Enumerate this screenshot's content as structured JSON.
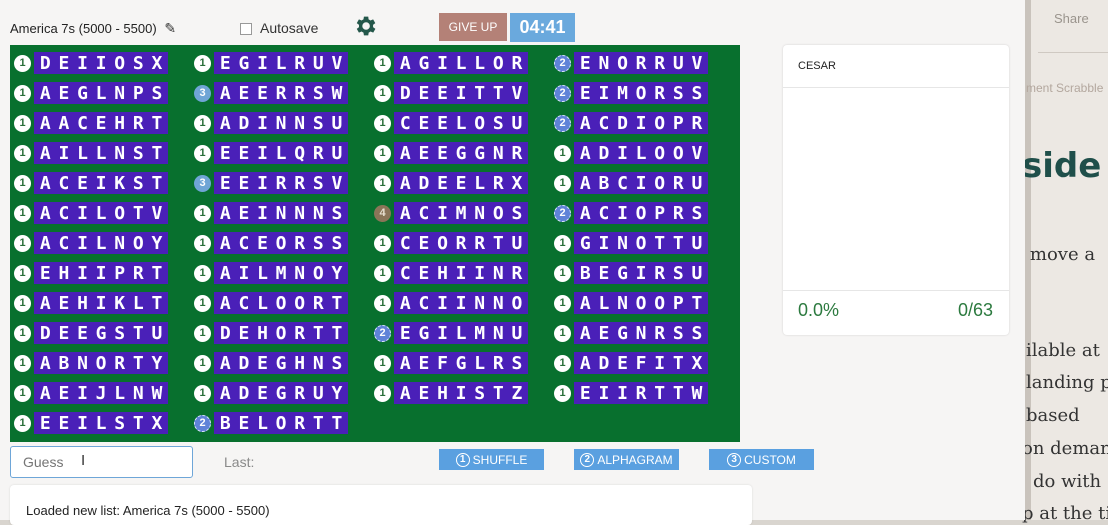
{
  "header": {
    "list_title": "America 7s (5000 - 5500)",
    "autosave_label": "Autosave",
    "give_up_label": "GIVE UP",
    "timer": "04:41"
  },
  "colors": {
    "board": "#08702e",
    "tile": "#4a20b8",
    "timer": "#6aa9dd",
    "give_up": "#b48177",
    "stat_text": "#2c7a3f"
  },
  "board": {
    "columns": [
      [
        {
          "count": "1",
          "letters": "DEIIOSX"
        },
        {
          "count": "1",
          "letters": "AEGLNPS"
        },
        {
          "count": "1",
          "letters": "AACEHRT"
        },
        {
          "count": "1",
          "letters": "AILLNST"
        },
        {
          "count": "1",
          "letters": "ACEIKST"
        },
        {
          "count": "1",
          "letters": "ACILOTV"
        },
        {
          "count": "1",
          "letters": "ACILNOY"
        },
        {
          "count": "1",
          "letters": "EHIIPRT"
        },
        {
          "count": "1",
          "letters": "AEHIKLT"
        },
        {
          "count": "1",
          "letters": "DEEGSTU"
        },
        {
          "count": "1",
          "letters": "ABNORTY"
        },
        {
          "count": "1",
          "letters": "AEIJLNW"
        },
        {
          "count": "1",
          "letters": "EEILSTX"
        }
      ],
      [
        {
          "count": "1",
          "letters": "EGILRUV"
        },
        {
          "count": "3",
          "letters": "AEERRSW"
        },
        {
          "count": "1",
          "letters": "ADINNSU"
        },
        {
          "count": "1",
          "letters": "EEILQRU"
        },
        {
          "count": "3",
          "letters": "EEIRRSV"
        },
        {
          "count": "1",
          "letters": "AEINNNS"
        },
        {
          "count": "1",
          "letters": "ACEORSS"
        },
        {
          "count": "1",
          "letters": "AILMNOY"
        },
        {
          "count": "1",
          "letters": "ACLOORT"
        },
        {
          "count": "1",
          "letters": "DEHORTT"
        },
        {
          "count": "1",
          "letters": "ADEGHNS"
        },
        {
          "count": "1",
          "letters": "ADEGRUY"
        },
        {
          "count": "2",
          "letters": "BELORTT"
        }
      ],
      [
        {
          "count": "1",
          "letters": "AGILLOR"
        },
        {
          "count": "1",
          "letters": "DEEITTV"
        },
        {
          "count": "1",
          "letters": "CEELOSU"
        },
        {
          "count": "1",
          "letters": "AEEGGNR"
        },
        {
          "count": "1",
          "letters": "ADEELRX"
        },
        {
          "count": "4",
          "letters": "ACIMNOS"
        },
        {
          "count": "1",
          "letters": "CEORRTU"
        },
        {
          "count": "1",
          "letters": "CEHIINR"
        },
        {
          "count": "1",
          "letters": "ACIINNO"
        },
        {
          "count": "2",
          "letters": "EGILMNU"
        },
        {
          "count": "1",
          "letters": "AEFGLRS"
        },
        {
          "count": "1",
          "letters": "AEHISTZ"
        }
      ],
      [
        {
          "count": "2",
          "letters": "ENORRUV"
        },
        {
          "count": "2",
          "letters": "EIMORSS"
        },
        {
          "count": "2",
          "letters": "ACDIOPR"
        },
        {
          "count": "1",
          "letters": "ADILOOV"
        },
        {
          "count": "1",
          "letters": "ABCIORU"
        },
        {
          "count": "2",
          "letters": "ACIOPRS"
        },
        {
          "count": "1",
          "letters": "GINOTTU"
        },
        {
          "count": "1",
          "letters": "BEGIRSU"
        },
        {
          "count": "1",
          "letters": "ALNOOPT"
        },
        {
          "count": "1",
          "letters": "AEGNRSS"
        },
        {
          "count": "1",
          "letters": "ADEFITX"
        },
        {
          "count": "1",
          "letters": "EIIRTTW"
        }
      ]
    ]
  },
  "stats": {
    "player": "CESAR",
    "percent": "0.0%",
    "solved": "0/63"
  },
  "guess": {
    "placeholder": "Guess",
    "last_label": "Last:"
  },
  "buttons": {
    "shuffle": {
      "num": "1",
      "label": "SHUFFLE"
    },
    "alphagram": {
      "num": "2",
      "label": "ALPHAGRAM"
    },
    "custom": {
      "num": "3",
      "label": "CUSTOM"
    }
  },
  "log": {
    "message": "Loaded new list: America 7s (5000 - 5500)"
  },
  "background_page": {
    "share": "Share",
    "crumb": "ment Scrabble",
    "heading": "side",
    "lines": [
      "y move a",
      "ilable at",
      "landing p",
      "based",
      "on deman",
      "do with",
      "p at the ti"
    ]
  }
}
